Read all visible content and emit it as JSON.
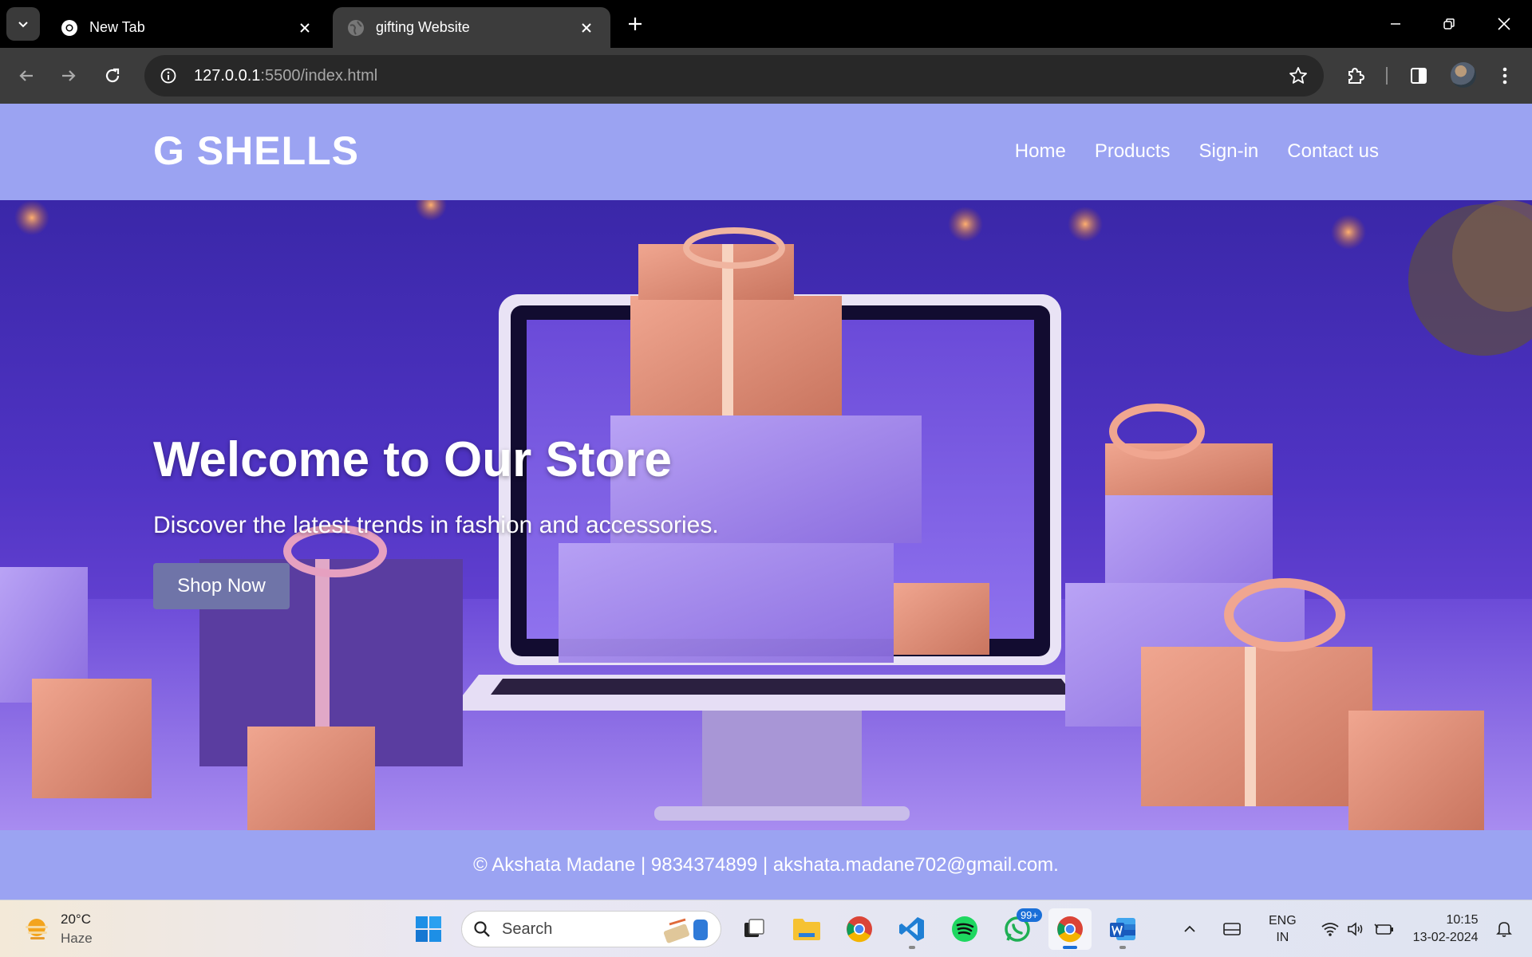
{
  "browser": {
    "tabs": [
      {
        "title": "New Tab",
        "active": false
      },
      {
        "title": "gifting Website",
        "active": true
      }
    ],
    "url_host": "127.0.0.1",
    "url_path": ":5500/index.html"
  },
  "site": {
    "logo": "G SHELLS",
    "nav": [
      "Home",
      "Products",
      "Sign-in",
      "Contact us"
    ],
    "hero": {
      "title": "Welcome to Our Store",
      "subtitle": "Discover the latest trends in fashion and accessories.",
      "cta": "Shop Now"
    },
    "footer": "© Akshata Madane | 9834374899 | akshata.madane702@gmail.com."
  },
  "taskbar": {
    "weather": {
      "temp": "20°C",
      "condition": "Haze"
    },
    "search_label": "Search",
    "whatsapp_badge": "99+",
    "language": {
      "line1": "ENG",
      "line2": "IN"
    },
    "clock": {
      "time": "10:15",
      "date": "13-02-2024"
    }
  },
  "colors": {
    "site_header": "#9ba3f2",
    "hero_top": "#3a27a8",
    "cta_button": "#6f74a8",
    "browser_toolbar": "#3c3c3c"
  }
}
